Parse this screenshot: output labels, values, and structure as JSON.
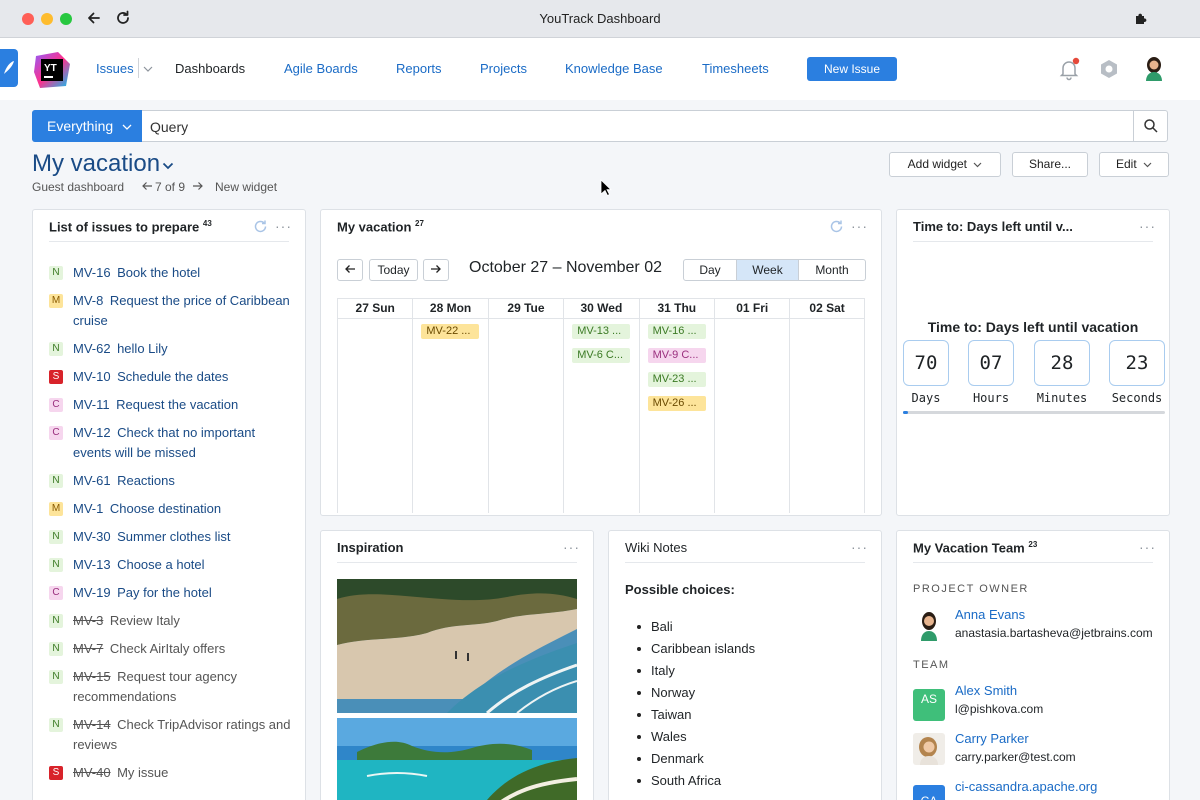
{
  "window": {
    "title": "YouTrack Dashboard"
  },
  "logo": {
    "text": "YT"
  },
  "nav": {
    "issues": "Issues",
    "dashboards": "Dashboards",
    "agile_boards": "Agile Boards",
    "reports": "Reports",
    "projects": "Projects",
    "knowledge_base": "Knowledge Base",
    "timesheets": "Timesheets",
    "new_issue": "New Issue"
  },
  "search": {
    "scope": "Everything",
    "placeholder": "Query"
  },
  "dashboard": {
    "title": "My vacation",
    "subtitle": "Guest dashboard",
    "pager": "7 of 9",
    "new_widget": "New widget",
    "add_widget": "Add widget",
    "share": "Share...",
    "edit": "Edit"
  },
  "issues_widget": {
    "title": "List of issues to prepare",
    "count": "43",
    "items": [
      {
        "type": "N",
        "id": "MV-16",
        "summary": "Book the hotel",
        "resolved": false
      },
      {
        "type": "M",
        "id": "MV-8",
        "summary": "Request the price of Caribbean cruise",
        "resolved": false
      },
      {
        "type": "N",
        "id": "MV-62",
        "summary": "hello Lily",
        "resolved": false
      },
      {
        "type": "S",
        "id": "MV-10",
        "summary": "Schedule the dates",
        "resolved": false
      },
      {
        "type": "C",
        "id": "MV-11",
        "summary": "Request the vacation",
        "resolved": false
      },
      {
        "type": "C",
        "id": "MV-12",
        "summary": "Check that no important events will be missed",
        "resolved": false
      },
      {
        "type": "N",
        "id": "MV-61",
        "summary": "Reactions",
        "resolved": false
      },
      {
        "type": "M",
        "id": "MV-1",
        "summary": "Choose destination",
        "resolved": false
      },
      {
        "type": "N",
        "id": "MV-30",
        "summary": "Summer clothes list",
        "resolved": false
      },
      {
        "type": "N",
        "id": "MV-13",
        "summary": "Choose a hotel",
        "resolved": false
      },
      {
        "type": "C",
        "id": "MV-19",
        "summary": "Pay for the hotel",
        "resolved": false
      },
      {
        "type": "N",
        "id": "MV-3",
        "summary": "Review Italy",
        "resolved": true
      },
      {
        "type": "N",
        "id": "MV-7",
        "summary": "Check AirItaly offers",
        "resolved": true
      },
      {
        "type": "N",
        "id": "MV-15",
        "summary": "Request tour agency recommendations",
        "resolved": true
      },
      {
        "type": "N",
        "id": "MV-14",
        "summary": "Check TripAdvisor ratings and reviews",
        "resolved": true
      },
      {
        "type": "S",
        "id": "MV-40",
        "summary": "My issue",
        "resolved": true
      }
    ]
  },
  "calendar_widget": {
    "title": "My vacation",
    "count": "27",
    "today": "Today",
    "range": "October 27 – November 02",
    "views": [
      "Day",
      "Week",
      "Month"
    ],
    "active_view": "Week",
    "days": [
      "27 Sun",
      "28 Mon",
      "29 Tue",
      "30 Wed",
      "31 Thu",
      "01 Fri",
      "02 Sat"
    ],
    "events": [
      {
        "day": 1,
        "row": 0,
        "type": "M",
        "label": "MV-22 ..."
      },
      {
        "day": 3,
        "row": 0,
        "type": "N",
        "label": "MV-13 ..."
      },
      {
        "day": 3,
        "row": 1,
        "type": "N",
        "label": "MV-6 C..."
      },
      {
        "day": 4,
        "row": 0,
        "type": "N",
        "label": "MV-16 ..."
      },
      {
        "day": 4,
        "row": 1,
        "type": "C",
        "label": "MV-9 C..."
      },
      {
        "day": 4,
        "row": 2,
        "type": "N",
        "label": "MV-23 ..."
      },
      {
        "day": 4,
        "row": 3,
        "type": "M",
        "label": "MV-26 ..."
      }
    ]
  },
  "countdown_widget": {
    "header": "Time to: Days left until v...",
    "title": "Time to: Days left until vacation",
    "days": {
      "value": "70",
      "label": "Days"
    },
    "hours": {
      "value": "07",
      "label": "Hours"
    },
    "minutes": {
      "value": "28",
      "label": "Minutes"
    },
    "seconds": {
      "value": "23",
      "label": "Seconds"
    },
    "progress_percent": 2
  },
  "inspiration_widget": {
    "title": "Inspiration"
  },
  "wiki_widget": {
    "title": "Wiki Notes",
    "heading": "Possible choices:",
    "items": [
      "Bali",
      "Caribbean islands",
      "Italy",
      "Norway",
      "Taiwan",
      "Wales",
      "Denmark",
      "South Africa"
    ]
  },
  "team_widget": {
    "title": "My Vacation Team",
    "count": "23",
    "owner_label": "PROJECT OWNER",
    "team_label": "TEAM",
    "owner": {
      "name": "Anna Evans",
      "email": "anastasia.bartasheva@jetbrains.com"
    },
    "members": [
      {
        "name": "Alex Smith",
        "email": "l@pishkova.com",
        "initials": "AS",
        "color": "#3fbf7a"
      },
      {
        "name": "Carry Parker",
        "email": "carry.parker@test.com"
      },
      {
        "name": "ci-cassandra.apache.org",
        "initials": "CA",
        "color": "#2b7fe0"
      }
    ]
  },
  "colors": {
    "accent": "#2b7fe0",
    "link": "#1a6bc6"
  }
}
